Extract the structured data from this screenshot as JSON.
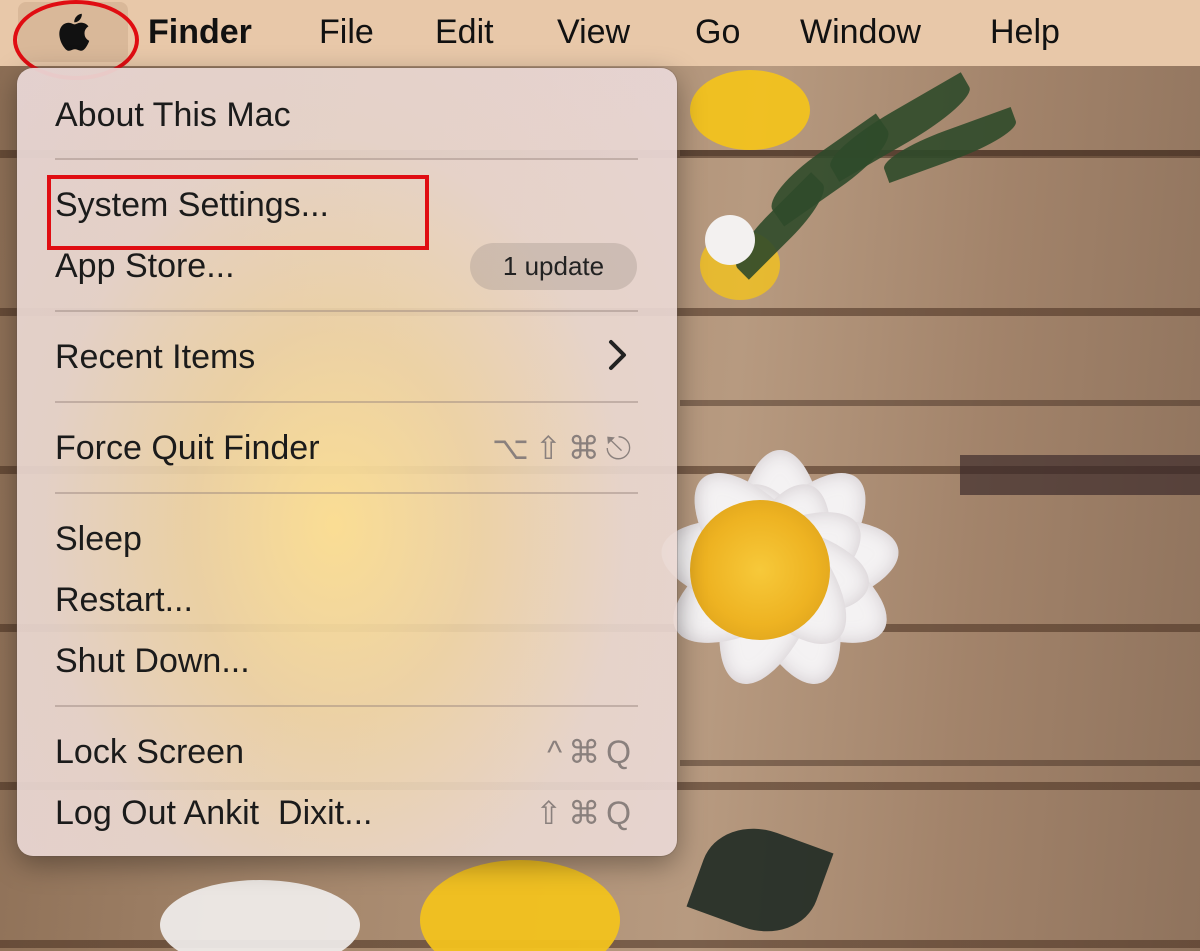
{
  "menubar": {
    "apple_icon": "apple-logo-icon",
    "app_name": "Finder",
    "menus": [
      "File",
      "Edit",
      "View",
      "Go",
      "Window",
      "Help"
    ]
  },
  "apple_menu": {
    "items": [
      {
        "label": "About This Mac"
      },
      {
        "label": "System Settings..."
      },
      {
        "label": "App Store...",
        "badge": "1 update"
      },
      {
        "label": "Recent Items",
        "submenu_icon": "chevron-right-icon"
      },
      {
        "label": "Force Quit Finder",
        "shortcut": "⌥⇧⌘⎋"
      },
      {
        "label": "Sleep"
      },
      {
        "label": "Restart..."
      },
      {
        "label": "Shut Down..."
      },
      {
        "label": "Lock Screen",
        "shortcut": "^⌘Q"
      },
      {
        "label": "Log Out Ankit  Dixit...",
        "shortcut": "⇧⌘Q"
      }
    ]
  },
  "annotations": {
    "highlight_color": "#e00d12",
    "highlighted_item": "System Settings..."
  }
}
